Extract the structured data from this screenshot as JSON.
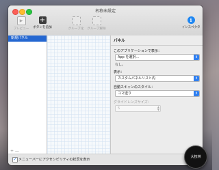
{
  "window": {
    "title": "名称未設定"
  },
  "toolbar": {
    "preview_label": "プレビュー",
    "add_button_label": "ボタンを追加",
    "group_label": "グループ化",
    "ungroup_label": "グループ解除",
    "inspector_label": "インスペクタ"
  },
  "sidebar": {
    "items": [
      {
        "label": "新規パネル"
      }
    ],
    "footer": "+ —"
  },
  "inspector": {
    "header": "パネル",
    "app_label": "このアプリケーションで表示：",
    "app_value": "App を選択...",
    "app_selected": "なし。",
    "display_label": "表示：",
    "display_value": "カスタムパネルリスト内",
    "scan_label": "自動スキャンのスタイル：",
    "scan_value": "コマ送り",
    "grid_label": "グライドレンズサイズ：",
    "grid_value": "5"
  },
  "bottom": {
    "checkbox_label": "メニューバーにアクセシビリティの状況を表示",
    "checked": true
  },
  "badge": {
    "text": "大技林"
  }
}
